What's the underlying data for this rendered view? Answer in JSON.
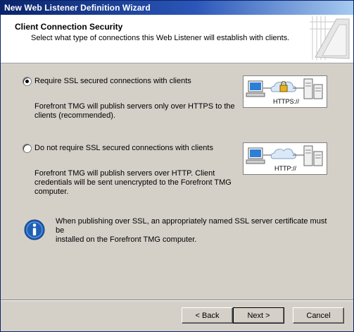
{
  "window": {
    "title": "New Web Listener Definition Wizard"
  },
  "header": {
    "title": "Client Connection Security",
    "subtitle": "Select what type of connections this Web Listener will establish with clients."
  },
  "options": [
    {
      "label": "Require SSL secured connections with clients",
      "selected": true,
      "description_lines": [
        "Forefront TMG will publish servers only over HTTPS to the",
        "clients (recommended)."
      ],
      "illustration_label": "HTTPS://",
      "illustration_icon": "lock-icon"
    },
    {
      "label": "Do not require SSL secured connections with clients",
      "selected": false,
      "description_lines": [
        "Forefront TMG will publish servers over HTTP. Client",
        "credentials will be sent unencrypted to the Forefront TMG",
        "computer."
      ],
      "illustration_label": "HTTP://",
      "illustration_icon": "cloud-icon"
    }
  ],
  "info": {
    "icon": "info-icon",
    "lines": [
      "When publishing over SSL, an appropriately named SSL server certificate must be",
      "installed on the Forefront TMG computer."
    ]
  },
  "buttons": {
    "back": "< Back",
    "next": "Next >",
    "cancel": "Cancel"
  },
  "colors": {
    "titlebar_start": "#0a246a",
    "titlebar_end": "#a6caf0",
    "dialog_bg": "#d4d0c8",
    "header_bg": "#ffffff",
    "info_icon": "#1f5fb5"
  }
}
